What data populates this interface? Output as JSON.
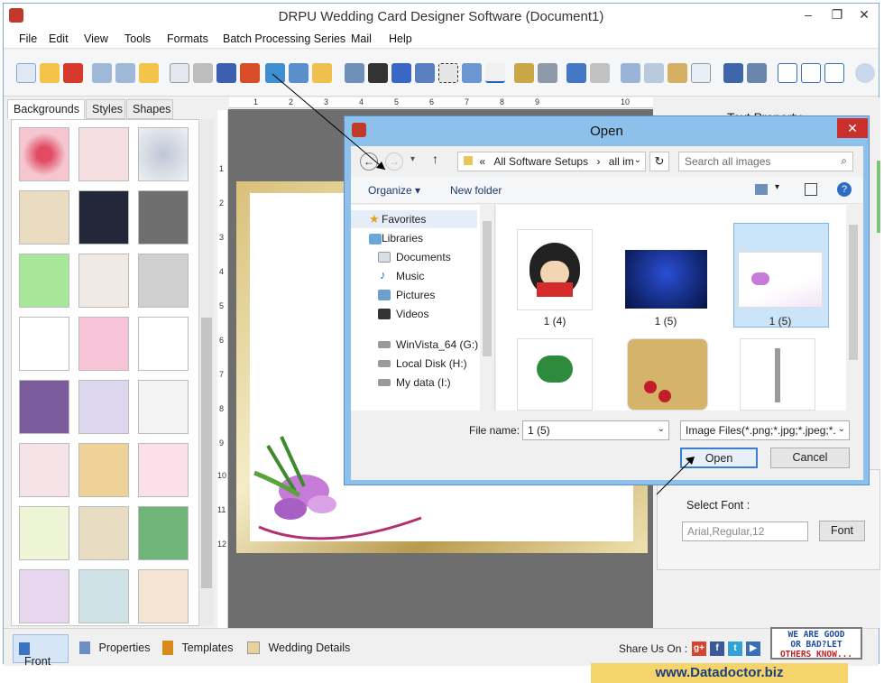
{
  "window": {
    "title": "DRPU Wedding Card Designer Software (Document1)",
    "controls": [
      "–",
      "❐",
      "✕"
    ]
  },
  "menu": [
    "File",
    "Edit",
    "View",
    "Tools",
    "Formats",
    "Batch Processing Series",
    "Mail",
    "Help"
  ],
  "left_panel": {
    "tabs": [
      "Backgrounds",
      "Styles",
      "Shapes"
    ],
    "active_tab": "Backgrounds"
  },
  "ruler": {
    "horizontal": [
      "1",
      "2",
      "3",
      "4",
      "5",
      "6",
      "7",
      "8",
      "9",
      "10"
    ],
    "vertical": [
      "1",
      "2",
      "3",
      "4",
      "5",
      "6",
      "7",
      "8",
      "9",
      "10",
      "11",
      "12"
    ]
  },
  "right_panel": {
    "title": "Text Property",
    "select_font_label": "Select Font :",
    "font_value": "Arial,Regular,12",
    "font_button": "Font"
  },
  "dialog": {
    "title": "Open",
    "close": "✕",
    "address": [
      "«",
      "All Software Setups",
      "›",
      "all im"
    ],
    "search_placeholder": "Search all images",
    "organize": "Organize ▾",
    "new_folder": "New folder",
    "nav": {
      "favorites": "Favorites",
      "libraries": "Libraries",
      "documents": "Documents",
      "music": "Music",
      "pictures": "Pictures",
      "videos": "Videos",
      "drive1": "WinVista_64 (G:)",
      "drive2": "Local Disk (H:)",
      "drive3": "My data (I:)"
    },
    "files": [
      {
        "label": "1 (4)",
        "selected": false
      },
      {
        "label": "1 (5)",
        "selected": false
      },
      {
        "label": "1 (5)",
        "selected": true
      }
    ],
    "file_name_label": "File name:",
    "file_name_value": "1 (5)",
    "file_type_value": "Image Files(*.png;*.jpg;*.jpeg;*.",
    "open_button": "Open",
    "cancel_button": "Cancel"
  },
  "bottom_tabs": [
    "Front",
    "Properties",
    "Templates",
    "Wedding Details"
  ],
  "share": {
    "label": "Share Us On :",
    "icons": [
      "g+",
      "f",
      "t",
      "▶"
    ]
  },
  "badge_lines": [
    "WE ARE GOOD",
    "OR BAD?LET",
    "OTHERS KNOW..."
  ],
  "footer_url": "www.Datadoctor.biz",
  "colors": {
    "dialog_frame": "#8dc0ea",
    "selection": "#cce4f7",
    "close_red": "#c9302c",
    "footer_bg": "#f5d56b"
  }
}
